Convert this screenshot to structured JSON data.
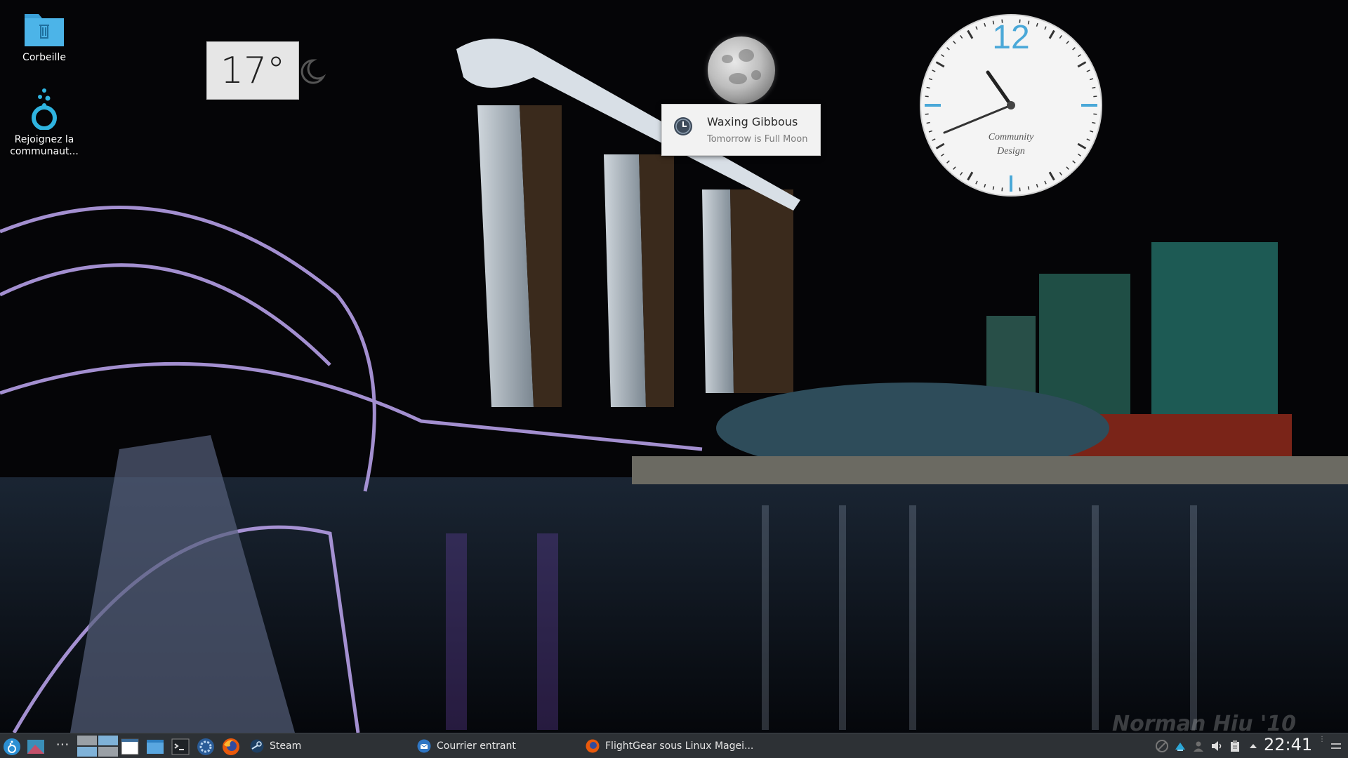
{
  "desktop": {
    "icons": [
      {
        "label": "Corbeille",
        "icon": "trash-folder-icon"
      },
      {
        "label": "Rejoignez la communaut...",
        "icon": "mageia-community-icon"
      }
    ],
    "watermark": "Norman Hiu '10"
  },
  "weather_widget": {
    "temperature": "17°",
    "condition_icon": "crescent-moon-icon"
  },
  "moon_widget": {
    "phase_title": "Waxing Gibbous",
    "phase_subtitle": "Tomorrow is Full Moon",
    "icon": "clock-icon"
  },
  "analog_clock": {
    "number_12": "12",
    "brand_line1": "Community",
    "brand_line2": "Design",
    "accent_color": "#4aa8d8"
  },
  "taskbar": {
    "launchers": [
      {
        "icon": "mageia-menu-icon"
      },
      {
        "icon": "desktop-icon"
      },
      {
        "icon": "more-icon",
        "label": "···"
      },
      {
        "icon": "pager-icon"
      },
      {
        "icon": "window-icon"
      },
      {
        "icon": "file-manager-icon"
      },
      {
        "icon": "terminal-icon"
      },
      {
        "icon": "settings-icon"
      },
      {
        "icon": "firefox-icon"
      }
    ],
    "tasks": [
      {
        "label": "Steam",
        "icon": "steam-icon"
      },
      {
        "label": "Courrier entrant",
        "icon": "thunderbird-icon"
      },
      {
        "label": "FlightGear sous Linux Magei...",
        "icon": "firefox-icon"
      }
    ],
    "tray": {
      "icons": [
        "network-icon",
        "update-icon",
        "user-icon",
        "volume-icon",
        "clipboard-icon",
        "expand-arrow-icon"
      ],
      "time": "22:41"
    }
  }
}
